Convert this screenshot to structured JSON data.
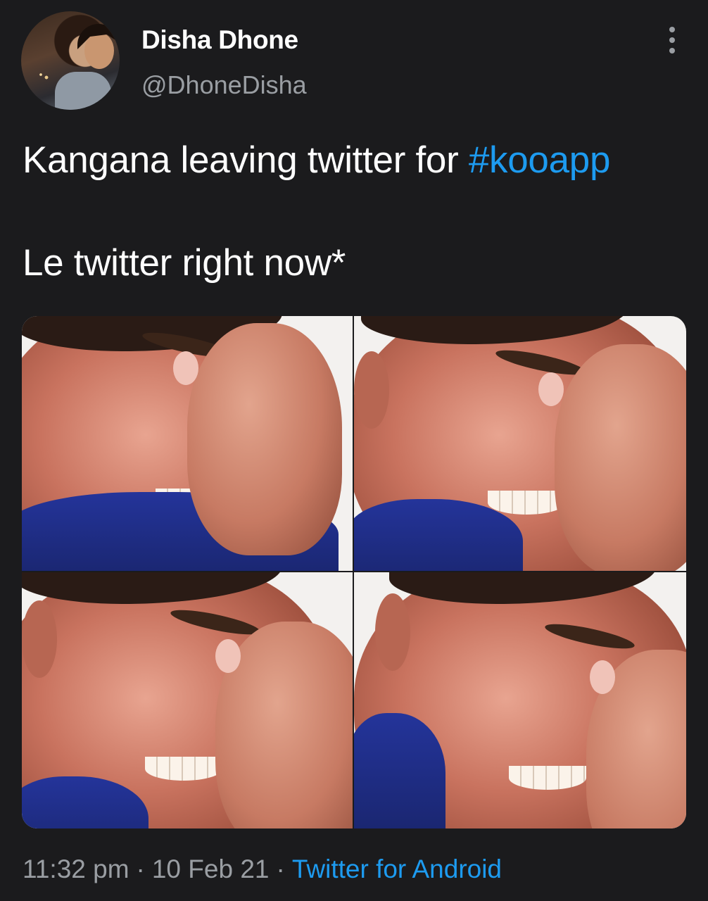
{
  "user": {
    "display_name": "Disha Dhone",
    "handle": "@DhoneDisha"
  },
  "tweet": {
    "text_line1_prefix": "Kangana leaving twitter for ",
    "hashtag": "#kooapp",
    "text_line2": "Le twitter right now*"
  },
  "meta": {
    "time": "11:32 pm",
    "separator": "·",
    "date": "10 Feb 21",
    "source": "Twitter for Android"
  },
  "icons": {
    "more": "more-vertical-icon"
  },
  "colors": {
    "background": "#1b1b1d",
    "link": "#1d9bf0",
    "secondary_text": "#9a9ea3"
  }
}
